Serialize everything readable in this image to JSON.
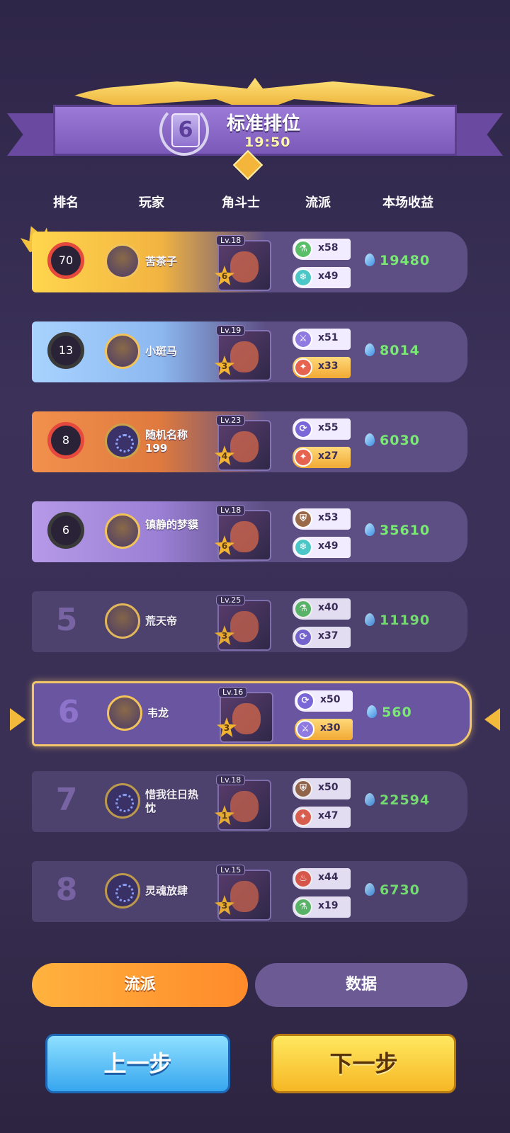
{
  "banner": {
    "tier": "6",
    "title": "标准排位",
    "time": "19:50"
  },
  "headers": [
    "排名",
    "玩家",
    "角斗士",
    "流派",
    "本场收益"
  ],
  "rows": [
    {
      "rank": "70",
      "name": "苦茶子",
      "level": "Lv.18",
      "stars": "6",
      "syn": [
        {
          "icon": "potion",
          "count": "x58"
        },
        {
          "icon": "snowflake",
          "count": "x49"
        }
      ],
      "earn": "19480"
    },
    {
      "rank": "13",
      "name": "小斑马",
      "level": "Lv.19",
      "stars": "3",
      "syn": [
        {
          "icon": "sword",
          "count": "x51"
        },
        {
          "icon": "claw",
          "count": "x33"
        }
      ],
      "earn": "8014"
    },
    {
      "rank": "8",
      "name": "随机名称199",
      "level": "Lv.23",
      "stars": "4",
      "syn": [
        {
          "icon": "cycle",
          "count": "x55"
        },
        {
          "icon": "claw",
          "count": "x27"
        }
      ],
      "earn": "6030"
    },
    {
      "rank": "6",
      "name": "镇静的梦貘",
      "level": "Lv.18",
      "stars": "6",
      "syn": [
        {
          "icon": "shield",
          "count": "x53"
        },
        {
          "icon": "snowflake",
          "count": "x49"
        }
      ],
      "earn": "35610"
    },
    {
      "rank": "5",
      "name": "荒天帝",
      "level": "Lv.25",
      "stars": "3",
      "syn": [
        {
          "icon": "potion",
          "count": "x40"
        },
        {
          "icon": "cycle",
          "count": "x37"
        }
      ],
      "earn": "11190"
    },
    {
      "rank": "6",
      "name": "韦龙",
      "level": "Lv.16",
      "stars": "3",
      "syn": [
        {
          "icon": "cycle",
          "count": "x50"
        },
        {
          "icon": "sword",
          "count": "x30"
        }
      ],
      "earn": "560"
    },
    {
      "rank": "7",
      "name": "惜我往日热忱",
      "level": "Lv.18",
      "stars": "1",
      "syn": [
        {
          "icon": "shield",
          "count": "x50"
        },
        {
          "icon": "claw",
          "count": "x47"
        }
      ],
      "earn": "22594"
    },
    {
      "rank": "8",
      "name": "灵魂放肆",
      "level": "Lv.15",
      "stars": "3",
      "syn": [
        {
          "icon": "fire",
          "count": "x44"
        },
        {
          "icon": "potion",
          "count": "x19"
        }
      ],
      "earn": "6730"
    }
  ],
  "tabs": {
    "style": "流派",
    "data": "数据"
  },
  "buttons": {
    "prev": "上一步",
    "next": "下一步"
  }
}
